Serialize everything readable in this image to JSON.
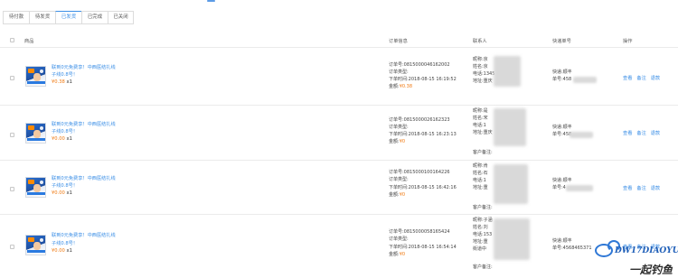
{
  "tabs": [
    "待付款",
    "待发货",
    "已发货",
    "已完成",
    "已关闭"
  ],
  "active_tab": 2,
  "headers": {
    "product": "商品",
    "order_info": "订单信息",
    "contact": "联系人",
    "shipping_no": "快递单号",
    "actions": "操作"
  },
  "orders": [
    {
      "title": "联到0元免费享！中西医结扎线",
      "subtitle": "子线0.8号！",
      "price": "¥0.38",
      "qty": "x1",
      "order_no": "订单号:0815000046162002",
      "order_type": "订单类型:",
      "order_time": "下单时间:2018-08-15 16:19:52",
      "total_label": "金额:",
      "total": "¥0.38",
      "contact_name": "昵称:京",
      "contact_real": "姓名:京",
      "contact_phone": "电话:1345",
      "contact_addr": "地址:重庆",
      "contact_note": "",
      "courier": "快递:顺丰",
      "tracking": "单号:458",
      "actions": [
        "查看",
        "备注",
        "退款"
      ]
    },
    {
      "title": "联到0元免费享！中西医结扎线",
      "subtitle": "子线0.8号！",
      "price": "¥0.00",
      "qty": "x1",
      "order_no": "订单号:0815000026162323",
      "order_type": "订单类型:",
      "order_time": "下单时间:2018-08-15 16:23:13",
      "total_label": "金额:",
      "total": "¥0",
      "contact_name": "昵称:是",
      "contact_real": "姓名:宋",
      "contact_phone": "电话:1",
      "contact_addr": "地址:重庆",
      "contact_note": "客户备注:",
      "courier": "快递:顺丰",
      "tracking": "单号:458",
      "actions": [
        "查看",
        "备注",
        "退款"
      ]
    },
    {
      "title": "联到0元免费享！中西医结扎线",
      "subtitle": "子线0.8号！",
      "price": "¥0.00",
      "qty": "x1",
      "order_no": "订单号:0815000100164226",
      "order_type": "订单类型:",
      "order_time": "下单时间:2018-08-15 16:42:16",
      "total_label": "金额:",
      "total": "¥0",
      "contact_name": "昵称:肯",
      "contact_real": "姓名:石",
      "contact_phone": "电话:1",
      "contact_addr": "地址:重",
      "contact_note": "客户备注:",
      "courier": "快递:顺丰",
      "tracking": "单号:4",
      "actions": [
        "查看",
        "备注",
        "退款"
      ]
    },
    {
      "title": "联到0元免费享！中西医结扎线",
      "subtitle": "子线0.8号！",
      "price": "¥0.00",
      "qty": "x1",
      "order_no": "订单号:0815000058165424",
      "order_type": "订单类型:",
      "order_time": "下单时间:2018-08-15 16:54:14",
      "total_label": "金额:",
      "total": "¥0",
      "contact_name": "昵称:子涵",
      "contact_real": "姓名:刘",
      "contact_phone": "电话:153",
      "contact_addr": "地址:重",
      "contact_district": "街道中",
      "contact_note": "客户备注:",
      "courier": "快递:顺丰",
      "tracking": "单号:4568465371",
      "actions": [
        "查看",
        "备注",
        "退款"
      ]
    }
  ],
  "watermark": {
    "brand": "DW17DIAOYU",
    "tagline": "一起钓鱼"
  }
}
